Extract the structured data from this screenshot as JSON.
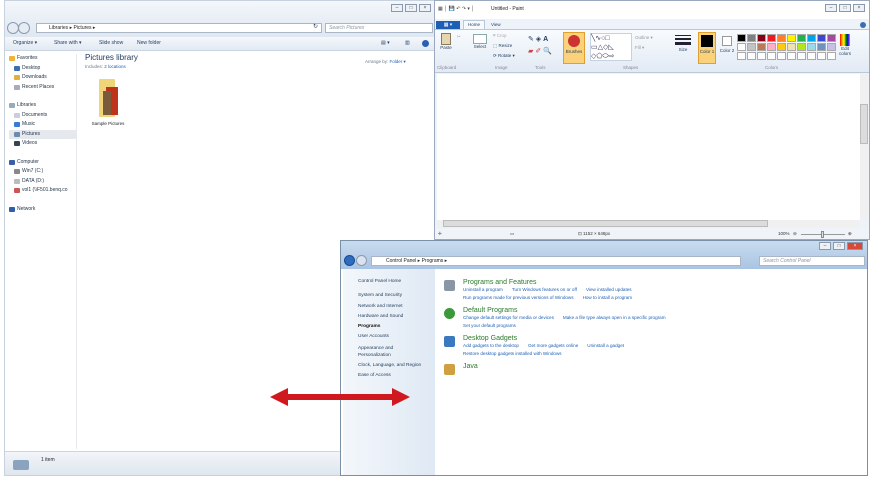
{
  "explorer": {
    "breadcrumb": [
      "Libraries",
      "Pictures"
    ],
    "search_placeholder": "Search Pictures",
    "toolbar": {
      "organize": "Organize ▾",
      "share": "Share with ▾",
      "slideshow": "Slide show",
      "new_folder": "New folder"
    },
    "nav": {
      "favorites": "Favorites",
      "desktop": "Desktop",
      "downloads": "Downloads",
      "recent": "Recent Places",
      "libraries": "Libraries",
      "documents": "Documents",
      "music": "Music",
      "pictures": "Pictures",
      "videos": "Videos",
      "computer": "Computer",
      "win7": "Win7 (C:)",
      "data": "DATA (D:)",
      "vol": "vol1 (\\\\F501.benq.co",
      "network": "Network"
    },
    "title": "Pictures library",
    "includes_label": "Includes:",
    "includes_link": "2 locations",
    "arrange_label": "Arrange by:",
    "arrange_value": "Folder ▾",
    "folder": "Sample Pictures",
    "status": "1 item"
  },
  "paint": {
    "title": "Untitled - Paint",
    "tabs": [
      "Home",
      "View"
    ],
    "groups": {
      "clipboard": "Clipboard",
      "image": "Image",
      "tools": "Tools",
      "shapes": "Shapes",
      "colors": "Colors"
    },
    "buttons": {
      "paste": "Paste",
      "select": "Select",
      "crop": "Crop",
      "resize": "Resize",
      "rotate": "Rotate ▾",
      "brushes": "Brushes",
      "outline": "Outline ▾",
      "fill": "Fill ▾",
      "size": "Size",
      "color1": "Color 1",
      "color2": "Color 2",
      "edit_colors": "Edit colors"
    },
    "palette": [
      "#000000",
      "#7f7f7f",
      "#880015",
      "#ed1c24",
      "#ff7f27",
      "#fff200",
      "#22b14c",
      "#00a2e8",
      "#3f48cc",
      "#a349a4",
      "#ffffff",
      "#c3c3c3",
      "#b97a57",
      "#ffaec9",
      "#ffc90e",
      "#efe4b0",
      "#b5e61d",
      "#99d9ea",
      "#7092be",
      "#c8bfe7"
    ],
    "dimensions": "1152 × 648px",
    "zoom": "100%",
    "zoom_fraction": 0.5
  },
  "control_panel": {
    "breadcrumb": [
      "Control Panel",
      "Programs"
    ],
    "search_placeholder": "Search Control Panel",
    "sidebar": [
      "Control Panel Home",
      "System and Security",
      "Network and Internet",
      "Hardware and Sound",
      "Programs",
      "User Accounts",
      "Appearance and Personalization",
      "Clock, Language, and Region",
      "Ease of Access"
    ],
    "sections": [
      {
        "title": "Programs and Features",
        "links": [
          "Uninstall a program",
          "Turn Windows features on or off",
          "View installed updates",
          "Run programs made for previous versions of Windows",
          "How to install a program"
        ]
      },
      {
        "title": "Default Programs",
        "links": [
          "Change default settings for media or devices",
          "Make a file type always open in a specific program",
          "Set your default programs"
        ]
      },
      {
        "title": "Desktop Gadgets",
        "links": [
          "Add gadgets to the desktop",
          "Get more gadgets online",
          "Uninstall a gadget",
          "Restore desktop gadgets installed with Windows"
        ]
      },
      {
        "title": "Java",
        "links": []
      }
    ]
  },
  "colors": {
    "arrow": "#d0191f",
    "link": "#1e5fb4",
    "heading": "#2a7a2a"
  }
}
